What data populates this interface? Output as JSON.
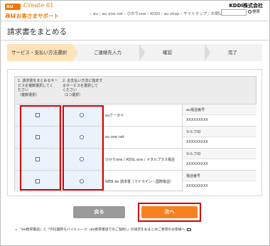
{
  "header": {
    "logo_au": "au one",
    "logo_create": "Create 81",
    "logo_main": "au",
    "logo_main_sub": "お客さまサポート",
    "company": "KDDI株式会社",
    "nav": "› au  › au one net  › ひかりone  › KDDI  › au shop  › サイトマップ  › お問い合わせ",
    "search_button": "検索"
  },
  "page": {
    "title": "請求書をまとめる"
  },
  "steps": [
    {
      "label": "サービス・支払い方法選択",
      "active": true
    },
    {
      "label": "ご連絡先入力",
      "active": false
    },
    {
      "label": "確認",
      "active": false
    },
    {
      "label": "完了",
      "active": false
    }
  ],
  "table": {
    "col1_header": [
      "1. 請求書をまとめるサー",
      "ビスを複数選択してく",
      "ださい",
      "（複数選択）"
    ],
    "col2_header": [
      "2. お支払い方法に指定す",
      "るサービスを選択して",
      "ください",
      "（1つ選択）"
    ],
    "rows": [
      {
        "service": "auケータイ",
        "sub_label": "au電話番号",
        "sub_value": "XXXXXXXXX"
      },
      {
        "service": "au one net",
        "sub_label": "セルフID",
        "sub_value": "XXXXXXXXX"
      },
      {
        "service": "ひかりone / ADSL one / メタルプラス電話",
        "sub_label": "セルフID",
        "sub_value": "XXXXXXXXX"
      },
      {
        "service": "WEB de 請求書（マイライン・国際電話）",
        "sub_label": "電話番号",
        "sub_value": "XXXXXXXXX"
      }
    ]
  },
  "buttons": {
    "back": "戻る",
    "next": "次へ"
  },
  "footnote": "「au携帯電話」と「001国際モバイルトーク（au携帯電話でのご契約）」の請求をおまとめご希望のお客様へ",
  "colors": {
    "accent": "#f07800",
    "next_button": "#f58220",
    "back_button": "#9a9a9a",
    "highlight": "#d40000",
    "active_step": "#fde3b8"
  }
}
